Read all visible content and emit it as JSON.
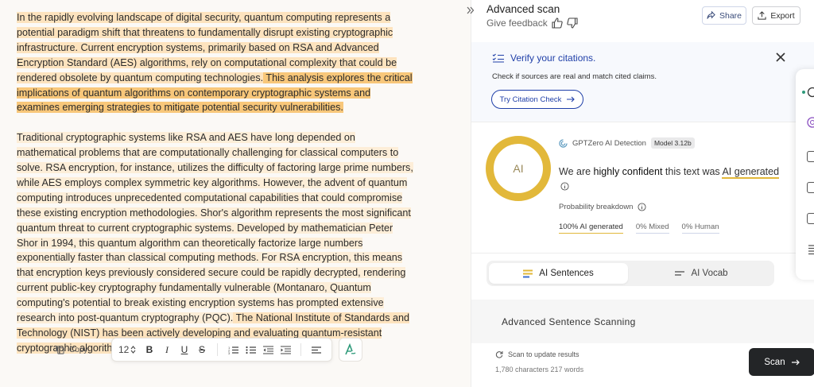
{
  "editor": {
    "p1_h1": "In the rapidly evolving landscape of digital security, quantum computing represents a potential paradigm shift that threatens to fundamentally disrupt existing cryptographic infrastructure. Current encryption systems, primarily based on RSA and Advanced Encryption Standard (AES) algorithms, rely on computational complexity that could be rendered obsolete by quantum computing technologies.",
    "p1_h2": " This analysis explores the critical implications of quantum algorithms on contemporary cryptographic systems and examines emerging strategies to mitigate potential security vulnerabilities.",
    "p2_h3": "Traditional cryptographic systems like RSA and AES have long depended on mathematical problems that are computationally challenging for classical computers to solve. RSA encryption, for instance, utilizes the difficulty of factoring large prime numbers, while AES employs complex symmetric key algorithms. However, the advent of quantum computing introduces unprecedented computational capabilities that could compromise these existing encryption methodologies. Shor's algorithm represents the most significant quantum threat to current cryptographic systems. Developed by mathematician Peter Shor in 1994, this quantum algorithm can theoretically factorize large numbers exponentially faster than classical computing methods. For RSA encryption, this means that encryption keys previously considered secure could be rapidly decrypted, rendering current public-key cryptography fundamentally vulnerable (Montanaro, Quantum computing's potential to break existing encryption systems has prompted extensive research into post-quantum cryptography (PQC).",
    "p2_h1": " The National Institute of Standards and Technology (NIST) has been actively developing and evaluating quantum-resistant cryptographic algorithms."
  },
  "toolbar": {
    "copy_label": "Copy",
    "font_size": "12"
  },
  "panel": {
    "title": "Advanced scan",
    "feedback": "Give feedback",
    "share": "Share",
    "export": "Export",
    "citation": {
      "title": "Verify your citations.",
      "desc": "Check if sources are real and match cited claims.",
      "button": "Try Citation Check"
    },
    "detection": {
      "ring_label": "AI",
      "brand": "GPTZero AI Detection",
      "model": "Model 3.12b",
      "text_a": "We are ",
      "text_b": "highly confident",
      "text_c": " this text was ",
      "text_d": "AI generated",
      "prob_title": "Probability breakdown",
      "prob_ai": "100% AI generated",
      "prob_mixed": "0% Mixed",
      "prob_human": "0% Human"
    },
    "tabs": {
      "a": "AI Sentences",
      "b": "AI Vocab"
    },
    "scan_title": "Advanced Sentence Scanning",
    "footer": {
      "update": "Scan to update results",
      "count": "1,780 characters 217 words",
      "scan_btn": "Scan"
    }
  },
  "colors": {
    "highlight_light": "#fde3be",
    "highlight_strong": "#f8c77a",
    "ring": "#e2b83a",
    "citation_blue": "#1f3fa8",
    "scan_button": "#232527"
  }
}
